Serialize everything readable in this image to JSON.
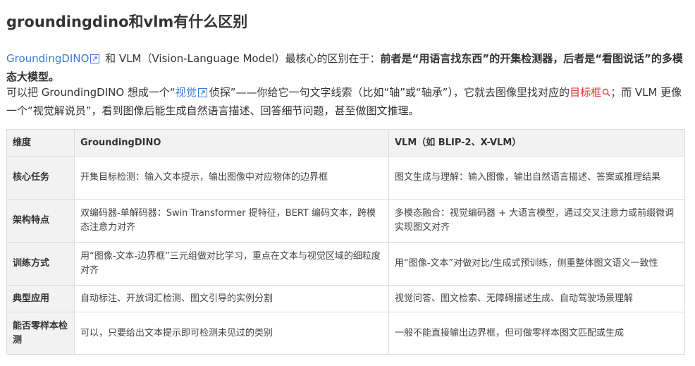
{
  "title": "groundingdino和vlm有什么区别",
  "intro": {
    "link_gd": "GroundingDINO",
    "text_a": " 和 VLM（Vision-Language Model）最核心的区别在于：",
    "bold": "前者是“用语言找东西”的开集检测器，后者是“看图说话”的多模态大模型。"
  },
  "analogy": {
    "text_a": "可以把 GroundingDINO 想成一个“",
    "link_visual": "视觉",
    "text_b": "侦探”——你给它一句文字线索（比如“轴”或“轴承”），它就去图像里找对应的",
    "link_box": "目标框",
    "text_c": "；而 VLM 更像一个“视觉解说员”，看到图像后能生成自然语言描述、回答细节问题，甚至做图文推理。"
  },
  "table": {
    "headers": [
      "维度",
      "GroundingDINO",
      "VLM（如 BLIP-2、X-VLM）"
    ],
    "rows": [
      [
        "核心任务",
        "开集目标检测：输入文本提示，输出图像中对应物体的边界框",
        "图文生成与理解：输入图像，输出自然语言描述、答案或推理结果"
      ],
      [
        "架构特点",
        "双编码器-单解码器：Swin Transformer 提特征，BERT 编码文本，跨模态注意力对齐",
        "多模态融合：视觉编码器 + 大语言模型，通过交叉注意力或前缀微调实现图文对齐"
      ],
      [
        "训练方式",
        "用“图像-文本-边界框”三元组做对比学习，重点在文本与视觉区域的细粒度对齐",
        "用“图像-文本”对做对比/生成式预训练，侧重整体图文语义一致性"
      ],
      [
        "典型应用",
        "自动标注、开放词汇检测、图文引导的实例分割",
        "视觉问答、图文检索、无障碍描述生成、自动驾驶场景理解"
      ],
      [
        "能否零样本检测",
        "可以，只要给出文本提示即可检测未见过的类别",
        "一般不能直接输出边界框，但可做零样本图文匹配或生成"
      ]
    ]
  },
  "colors": {
    "link": "#3a7bd5",
    "highlight": "#e0342f",
    "header_bg": "#f2f2f2",
    "border": "#dcdcdc"
  },
  "icons": {
    "external": "external-link-icon",
    "search": "search-icon"
  }
}
